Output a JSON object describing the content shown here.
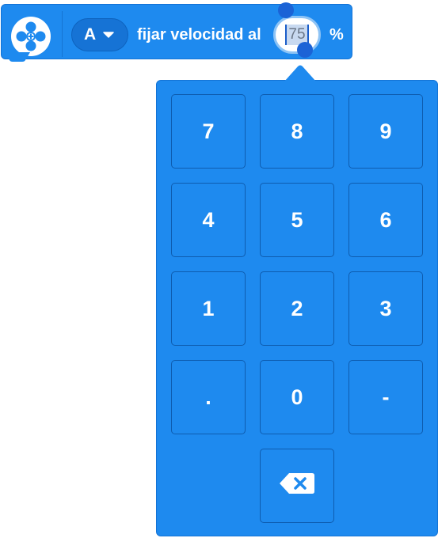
{
  "block": {
    "port": "A",
    "label": "fijar velocidad al",
    "speed_value": "75",
    "unit": "%"
  },
  "numpad": {
    "keys": [
      "7",
      "8",
      "9",
      "4",
      "5",
      "6",
      "1",
      "2",
      "3",
      ".",
      "0",
      "-"
    ],
    "backspace_icon": "backspace-icon"
  },
  "colors": {
    "block_blue": "#1E8AEF",
    "block_border": "#1373D6",
    "dropdown_blue": "#1673D5",
    "key_border": "#0E5CAF",
    "selection_handle": "#1B63D6"
  }
}
